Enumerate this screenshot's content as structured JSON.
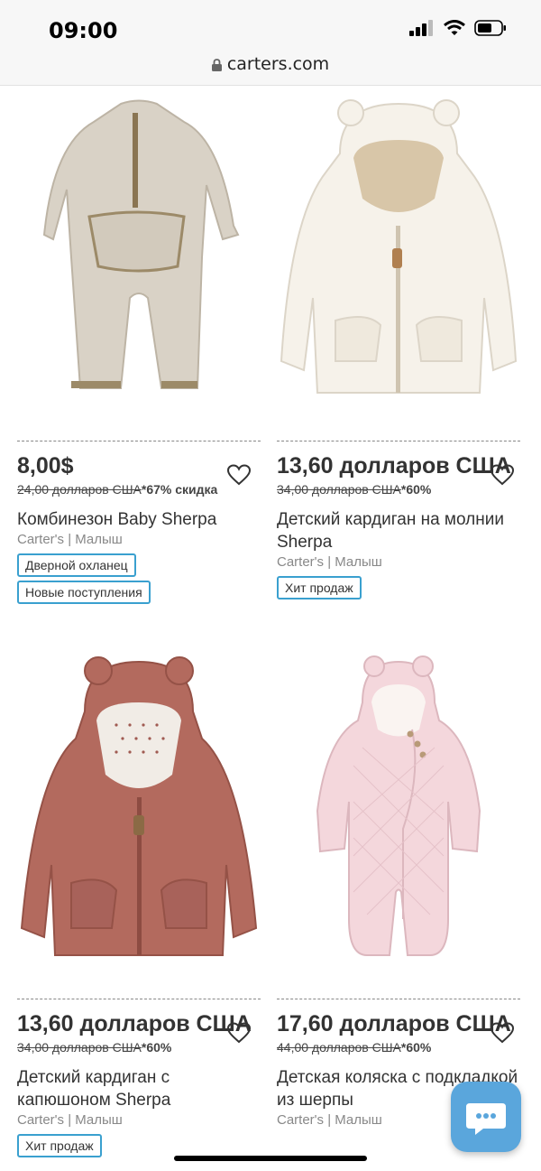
{
  "status": {
    "time": "09:00"
  },
  "browser": {
    "url": "carters.com"
  },
  "products": [
    {
      "price": "8,00$",
      "old_price": "24,00 долларов США",
      "discount": "*67% скидка",
      "name": "Комбинезон Baby Sherpa",
      "brand": "Carter's | Малыш",
      "tags": [
        "Дверной охланец",
        "Новые поступления"
      ],
      "color": "#d9d2c6"
    },
    {
      "price": "13,60 долларов США",
      "old_price": "34,00 долларов США",
      "discount": "*60%",
      "name": "Детский кардиган на молнии Sherpa",
      "brand": "Carter's | Малыш",
      "tags": [
        "Хит продаж"
      ],
      "color": "#f6f2ea"
    },
    {
      "price": "13,60 долларов США",
      "old_price": "34,00 долларов США",
      "discount": "*60%",
      "name": "Детский кардиган с капюшоном Sherpa",
      "brand": "Carter's | Малыш",
      "tags": [
        "Хит продаж"
      ],
      "color": "#b36a5e"
    },
    {
      "price": "17,60 долларов США",
      "old_price": "44,00 долларов США",
      "discount": "*60%",
      "name": "Детская коляска с подкладкой из шерпы",
      "brand": "Carter's | Малыш",
      "tags": [],
      "color": "#f4d7dc"
    }
  ],
  "colors": {
    "accent": "#3aa0cf",
    "chat": "#5aa6dc"
  },
  "icons": [
    "lock-icon",
    "signal-icon",
    "wifi-icon",
    "battery-icon",
    "heart-icon",
    "chat-icon"
  ]
}
